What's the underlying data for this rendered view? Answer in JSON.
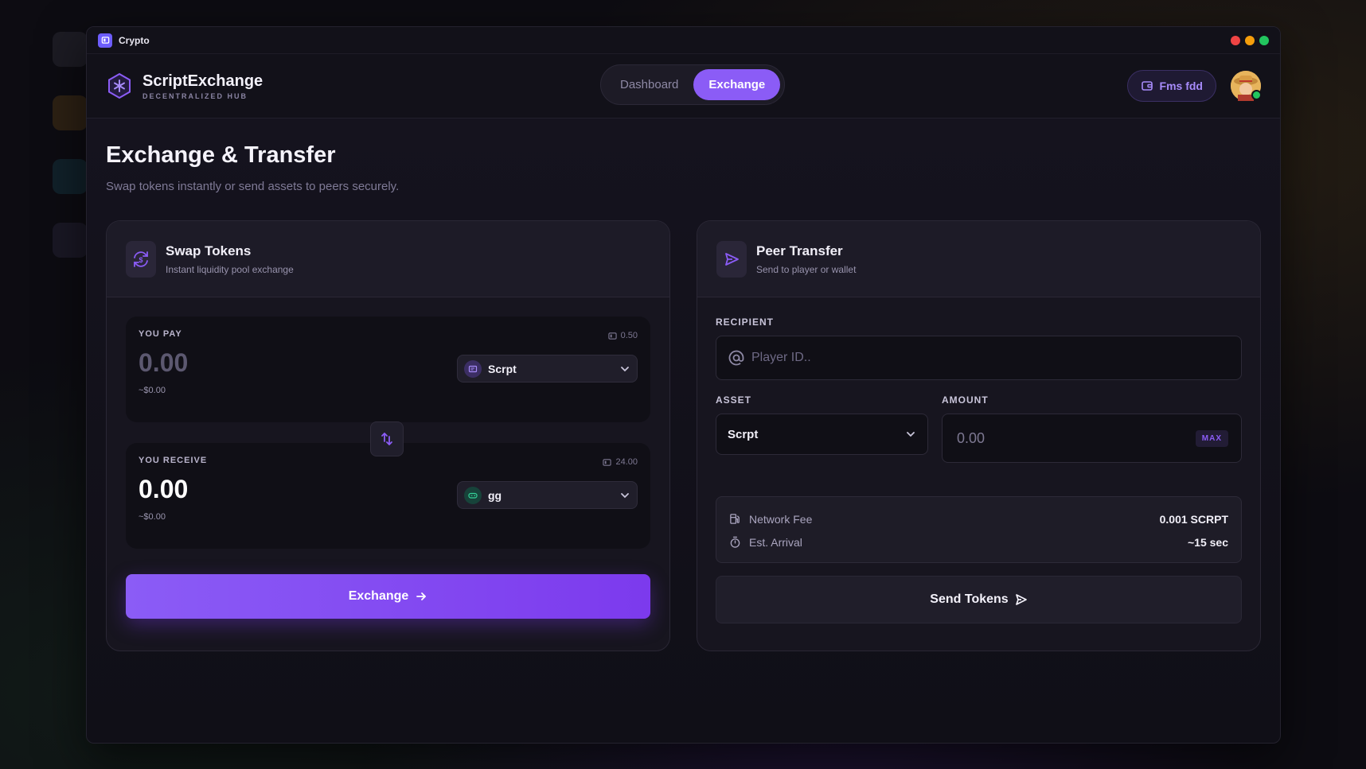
{
  "window": {
    "title": "Crypto"
  },
  "brand": {
    "name": "ScriptExchange",
    "subtitle": "DECENTRALIZED HUB"
  },
  "nav": {
    "tabs": [
      {
        "label": "Dashboard",
        "active": false
      },
      {
        "label": "Exchange",
        "active": true
      }
    ]
  },
  "wallet": {
    "label": "Fms fdd"
  },
  "page": {
    "title": "Exchange & Transfer",
    "subtitle": "Swap tokens instantly or send assets to peers securely."
  },
  "swap": {
    "title": "Swap Tokens",
    "subtitle": "Instant liquidity pool exchange",
    "pay": {
      "label": "YOU PAY",
      "balance": "0.50",
      "amount": "0.00",
      "usd": "~$0.00",
      "token": "Scrpt"
    },
    "receive": {
      "label": "YOU RECEIVE",
      "balance": "24.00",
      "amount": "0.00",
      "usd": "~$0.00",
      "token": "gg"
    },
    "button_label": "Exchange"
  },
  "transfer": {
    "title": "Peer Transfer",
    "subtitle": "Send to player or wallet",
    "recipient_label": "RECIPIENT",
    "recipient_placeholder": "Player ID..",
    "asset_label": "ASSET",
    "asset_value": "Scrpt",
    "amount_label": "AMOUNT",
    "amount_placeholder": "0.00",
    "max_label": "MAX",
    "fee_label": "Network Fee",
    "fee_value": "0.001 SCRPT",
    "arrival_label": "Est. Arrival",
    "arrival_value": "~15 sec",
    "button_label": "Send Tokens"
  },
  "colors": {
    "accent": "#8b5cf6",
    "online": "#22c55e",
    "close": "#ef4444",
    "minimize": "#f59e0b",
    "maximize": "#22c55e"
  }
}
